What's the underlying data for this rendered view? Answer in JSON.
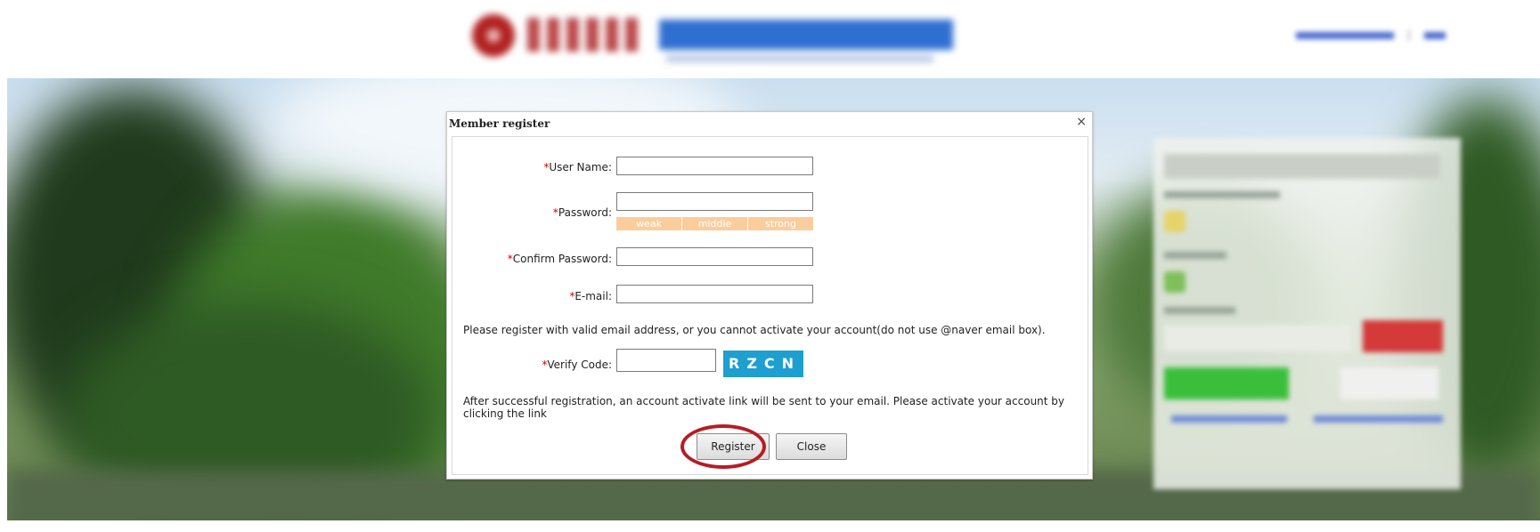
{
  "dialog": {
    "title": "Member register",
    "close_icon": "×",
    "fields": {
      "username_label": "User Name:",
      "password_label": "Password:",
      "confirm_label": "Confirm Password:",
      "email_label": "E-mail:",
      "verify_label": "Verify Code:"
    },
    "required_mark": "*",
    "strength": [
      "weak",
      "middle",
      "strong"
    ],
    "email_note": "Please register with valid email address, or you cannot activate your account(do not use @naver email box).",
    "captcha_text": "RZCN",
    "activation_note": "After successful registration, an account activate link will be sent to your email. Please activate your account by clicking the link",
    "register_button": "Register",
    "close_button": "Close"
  },
  "colors": {
    "required": "#d40000",
    "strength_bar": "#fbcd9d",
    "captcha_bg": "#1e9fcf",
    "highlight_ring": "#b51d25"
  }
}
